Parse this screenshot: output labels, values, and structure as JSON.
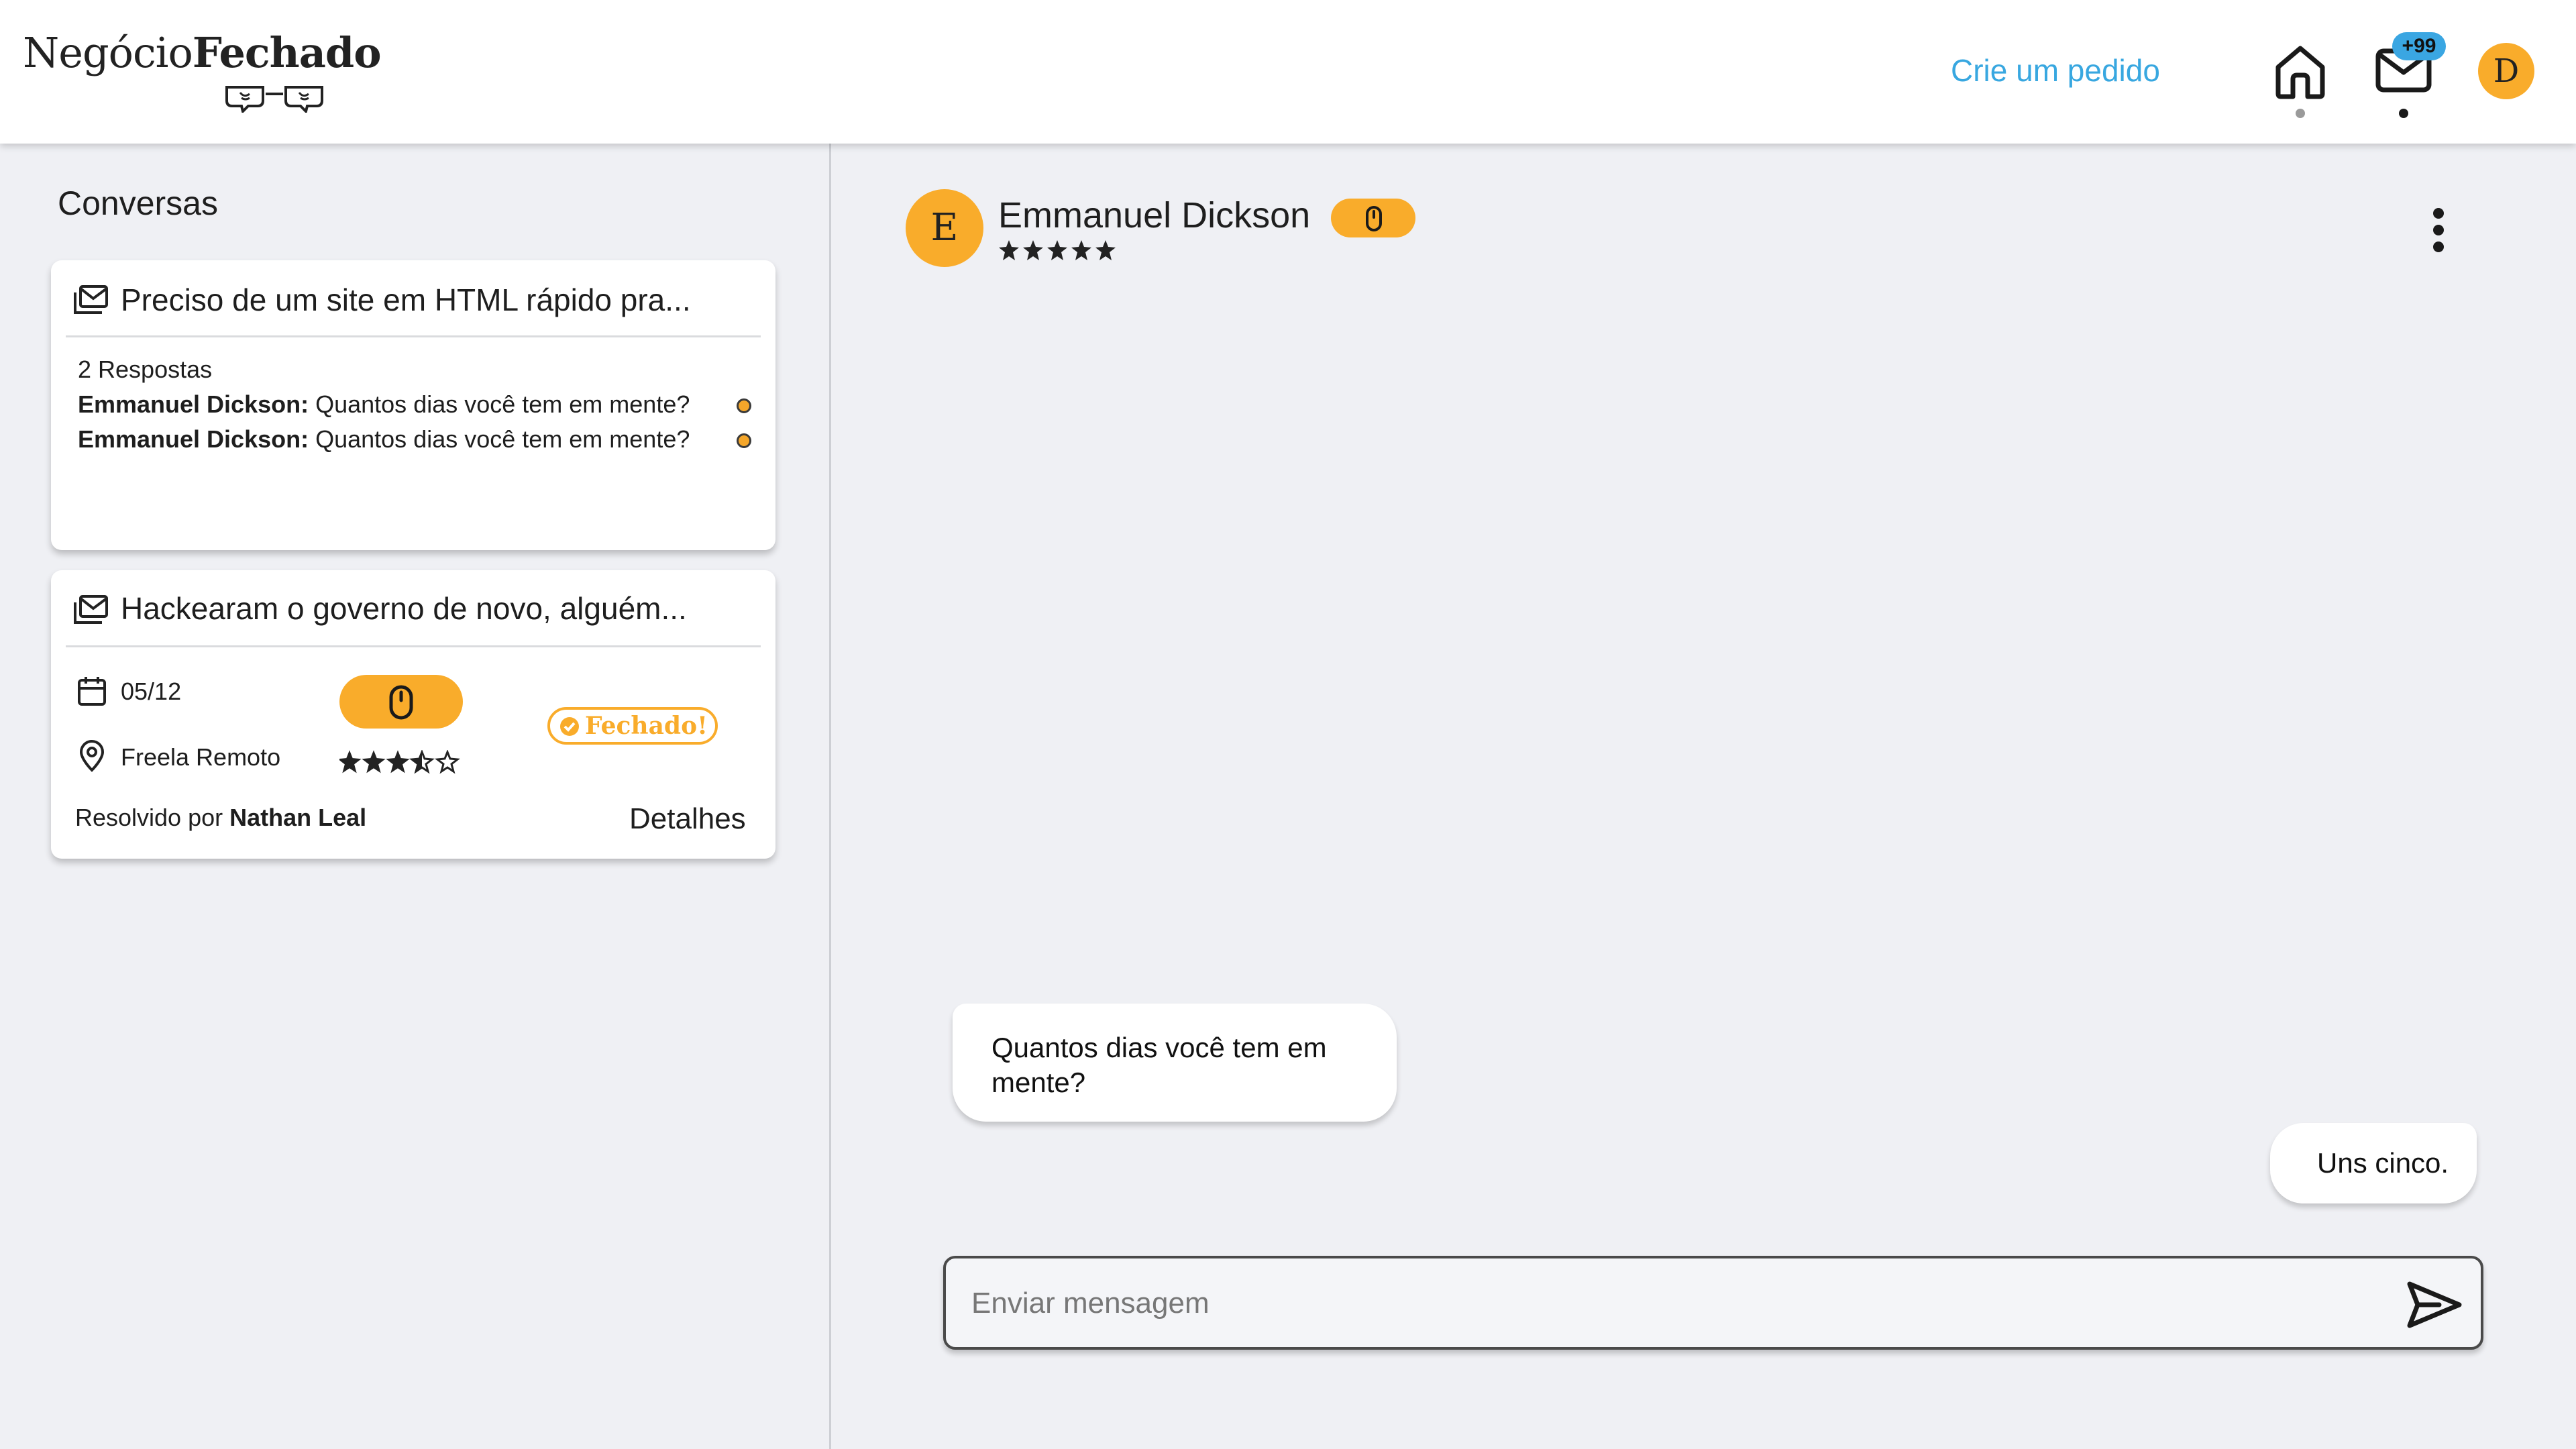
{
  "header": {
    "logo_part1": "Negócio",
    "logo_part2": "Fechado",
    "create_link": "Crie um pedido",
    "notification_badge": "+99",
    "user_initial": "D",
    "accent_color": "#f9ac2b",
    "link_color": "#38a7e0"
  },
  "sidebar": {
    "title": "Conversas",
    "cards": [
      {
        "title": "Preciso de um site em HTML rápido pra...",
        "replies_label": "2 Respostas",
        "messages": [
          {
            "author": "Emmanuel Dickson:",
            "text": " Quantos dias você tem em mente?",
            "unread": true
          },
          {
            "author": "Emmanuel Dickson:",
            "text": " Quantos dias você tem em mente?",
            "unread": true
          }
        ]
      },
      {
        "title": "Hackearam o governo de novo, alguém...",
        "date": "05/12",
        "location": "Freela Remoto",
        "rating": 3.5,
        "status": "Fechado!",
        "resolved_prefix": "Resolvido por ",
        "resolved_by": "Nathan Leal",
        "details_label": "Detalhes"
      }
    ]
  },
  "chat": {
    "contact_initial": "E",
    "contact_name": "Emmanuel Dickson",
    "contact_rating": 5,
    "messages": [
      {
        "side": "received",
        "text": "Quantos dias você tem em mente?"
      },
      {
        "side": "sent",
        "text": "Uns cinco."
      }
    ],
    "input_placeholder": "Enviar mensagem"
  }
}
